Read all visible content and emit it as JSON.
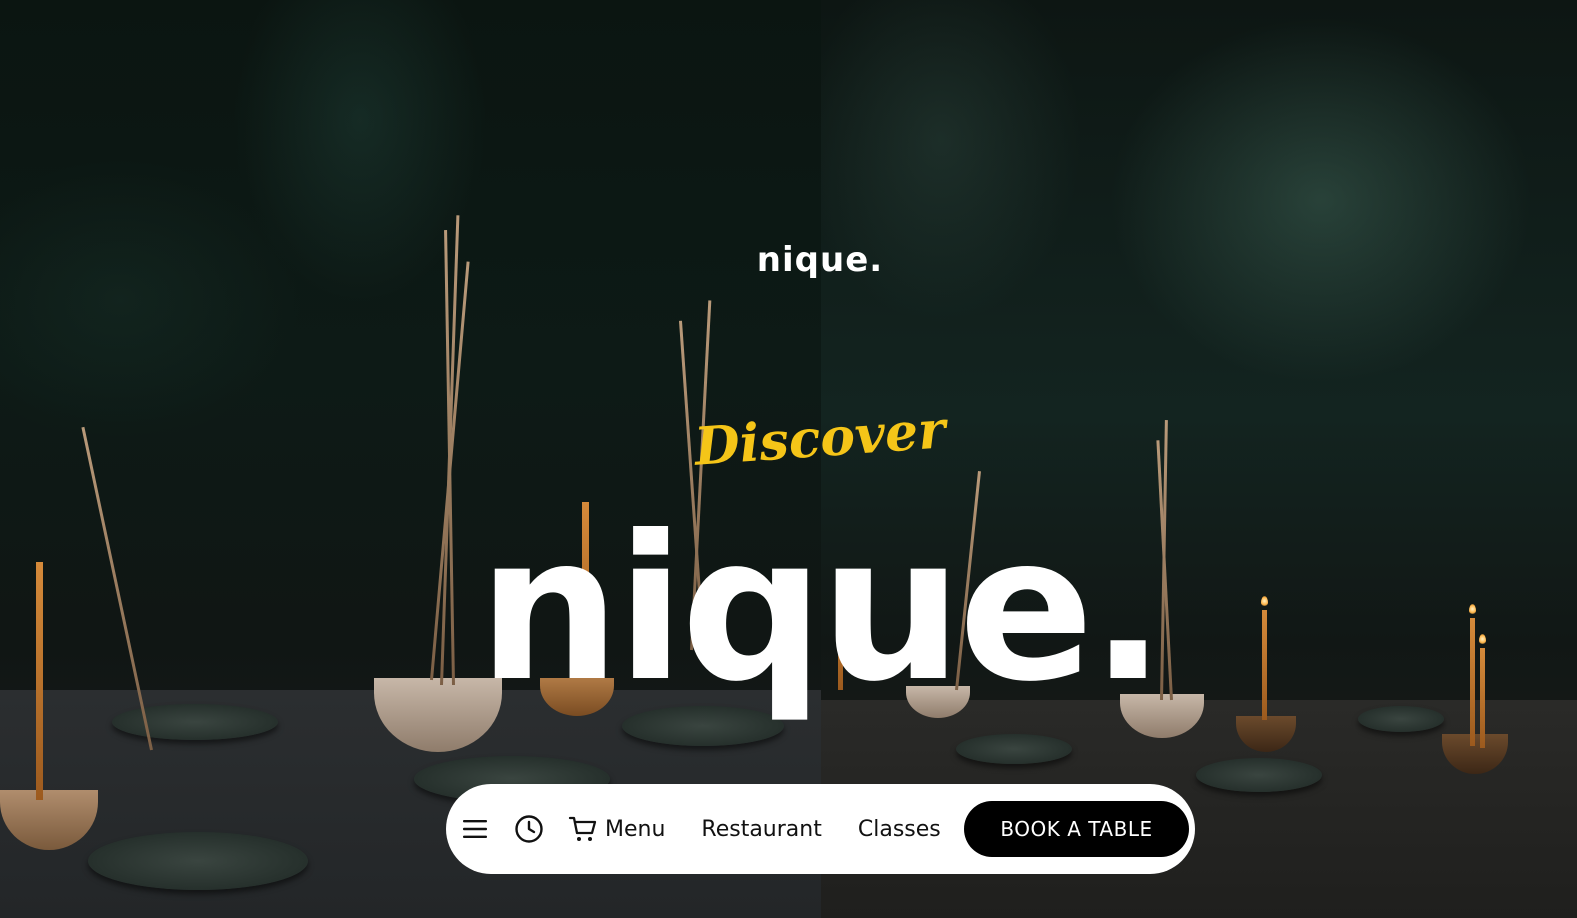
{
  "brand": {
    "logo_small": "nique.",
    "tagline": "Discover",
    "title": "nique."
  },
  "nav": {
    "icons": [
      "hamburger-menu-icon",
      "clock-icon",
      "cart-icon"
    ],
    "links": [
      "Menu",
      "Restaurant",
      "Classes"
    ],
    "cta_label": "BOOK A TABLE"
  },
  "colors": {
    "accent": "#f5c518",
    "nav_bg": "#ffffff",
    "cta_bg": "#000000",
    "cta_text": "#ffffff"
  }
}
